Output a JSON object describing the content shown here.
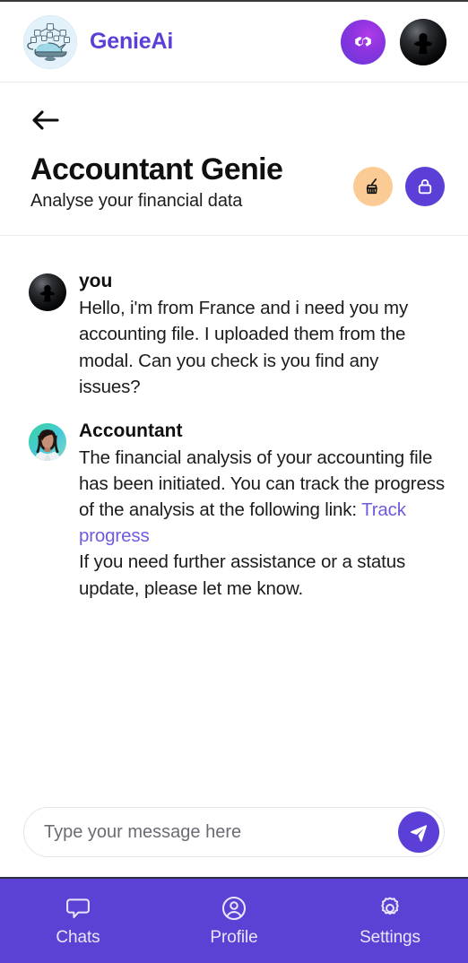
{
  "brand": {
    "name": "GenieAi",
    "logo_icon": "genie-lamp-icon",
    "chain_icon": "polygon-logo-icon",
    "wallet_icon": "dark-hat-avatar-icon",
    "color": "#5B3FD6"
  },
  "header": {
    "back_icon": "back-arrow-icon",
    "title": "Accountant Genie",
    "subtitle": "Analyse your financial data",
    "actions": [
      {
        "name": "clear-chat-button",
        "icon": "broom-icon",
        "bg": "#FBCB95",
        "fg": "#141414"
      },
      {
        "name": "lock-button",
        "icon": "lock-icon",
        "bg": "#5B3FD6",
        "fg": "#ffffff"
      }
    ]
  },
  "chat": {
    "messages": [
      {
        "author": "you",
        "avatar_icon": "dark-hat-avatar-icon",
        "text": "Hello, i'm from France and i need you my accounting file. I uploaded them from the modal. Can you check is you find any issues?"
      },
      {
        "author": "Accountant",
        "avatar_icon": "accountant-portrait-avatar",
        "text_before_link": "The financial analysis of your accounting file has been initiated. You can track the progress of the analysis at the following link: ",
        "link_text": "Track progress",
        "link_color": "#6F5BDD",
        "text_after_link": "If you need further assistance or a status update, please let me know."
      }
    ]
  },
  "composer": {
    "placeholder": "Type your message here",
    "value": "",
    "send_icon": "send-paper-plane-icon",
    "send_color": "#5B3FD6"
  },
  "bottom_nav": {
    "background": "#5B42D4",
    "items": [
      {
        "label": "Chats",
        "icon": "chat-bubble-icon"
      },
      {
        "label": "Profile",
        "icon": "user-circle-icon"
      },
      {
        "label": "Settings",
        "icon": "gear-icon"
      }
    ]
  }
}
